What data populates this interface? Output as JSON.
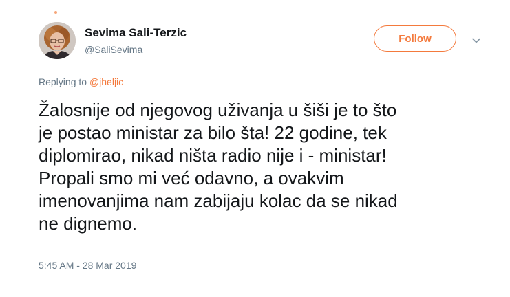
{
  "author": {
    "display_name": "Sevima Sali-Terzic",
    "handle": "@SaliSevima",
    "avatar_icon": "profile-photo"
  },
  "actions": {
    "follow_label": "Follow",
    "menu_icon": "chevron-down-icon"
  },
  "reply": {
    "prefix": "Replying to",
    "mention": "@jheljic"
  },
  "tweet": {
    "lines": [
      "Žalosnije od njegovog uživanja u šiši je to što",
      "je postao ministar za bilo šta! 22 godine, tek",
      "diplomirao, nikad ništa radio nije i - ministar!",
      "Propali smo mi već odavno, a ovakvim",
      "imenovanjima nam zabijaju kolac da se nikad",
      "ne dignemo."
    ],
    "timestamp": "5:45 AM - 28 Mar 2019"
  },
  "colors": {
    "accent": "#f47a3d",
    "text": "#14171a",
    "muted": "#657786"
  }
}
